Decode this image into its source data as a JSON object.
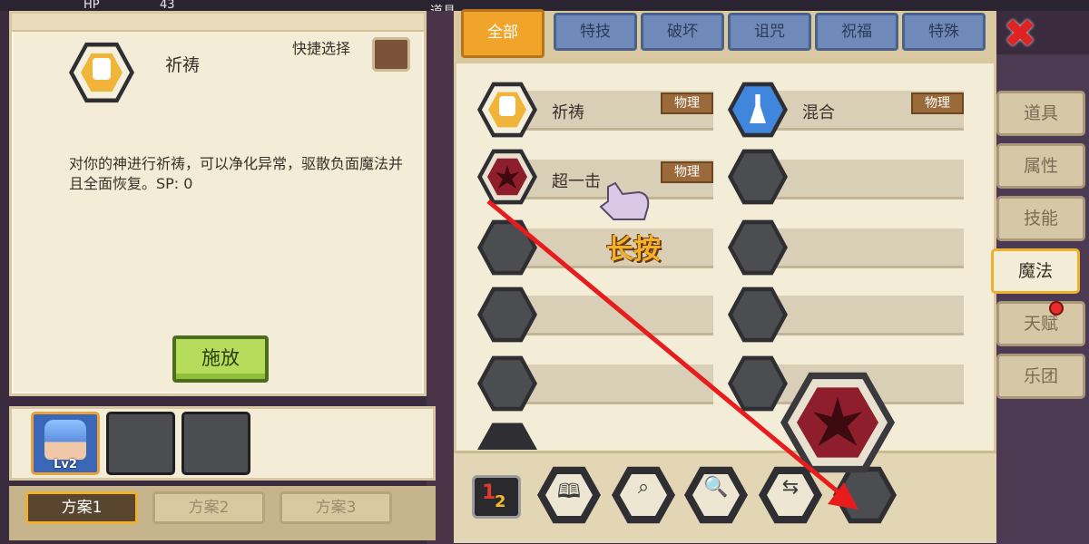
{
  "detail": {
    "skill_name": "祈祷",
    "quick_select_label": "快捷选择",
    "description": "对你的神进行祈祷，可以净化异常，驱散负面魔法并且全面恢复。SP: 0",
    "cast_button": "施放"
  },
  "party": {
    "members": [
      {
        "level": "Lv2",
        "filled": true
      },
      {
        "filled": false
      },
      {
        "filled": false
      }
    ]
  },
  "plans": [
    "方案1",
    "方案2",
    "方案3"
  ],
  "category_tabs": [
    "全部",
    "特技",
    "破坏",
    "诅咒",
    "祝福",
    "特殊"
  ],
  "skills": [
    {
      "name": "祈祷",
      "type": "物理",
      "icon": "prayer-icon"
    },
    {
      "name": "混合",
      "type": "物理",
      "icon": "flask-icon"
    },
    {
      "name": "超一击",
      "type": "物理",
      "icon": "super-strike-icon"
    }
  ],
  "hint": "长按",
  "side_tabs": [
    "道具",
    "属性",
    "技能",
    "魔法",
    "天赋",
    "乐团"
  ],
  "topbar": {
    "hp_label": "HP",
    "hp_value": "43",
    "items_label": "道具"
  },
  "toolbar": {
    "icons": [
      "sort-order-icon",
      "book-icon",
      "search-skill-icon",
      "zoom-icon",
      "swap-icon",
      "empty-slot-icon"
    ]
  },
  "colors": {
    "accent": "#f0a52a",
    "tab_blue": "#6f8ab8",
    "panel": "#f3ecd7",
    "arrow": "#e81c1c"
  }
}
